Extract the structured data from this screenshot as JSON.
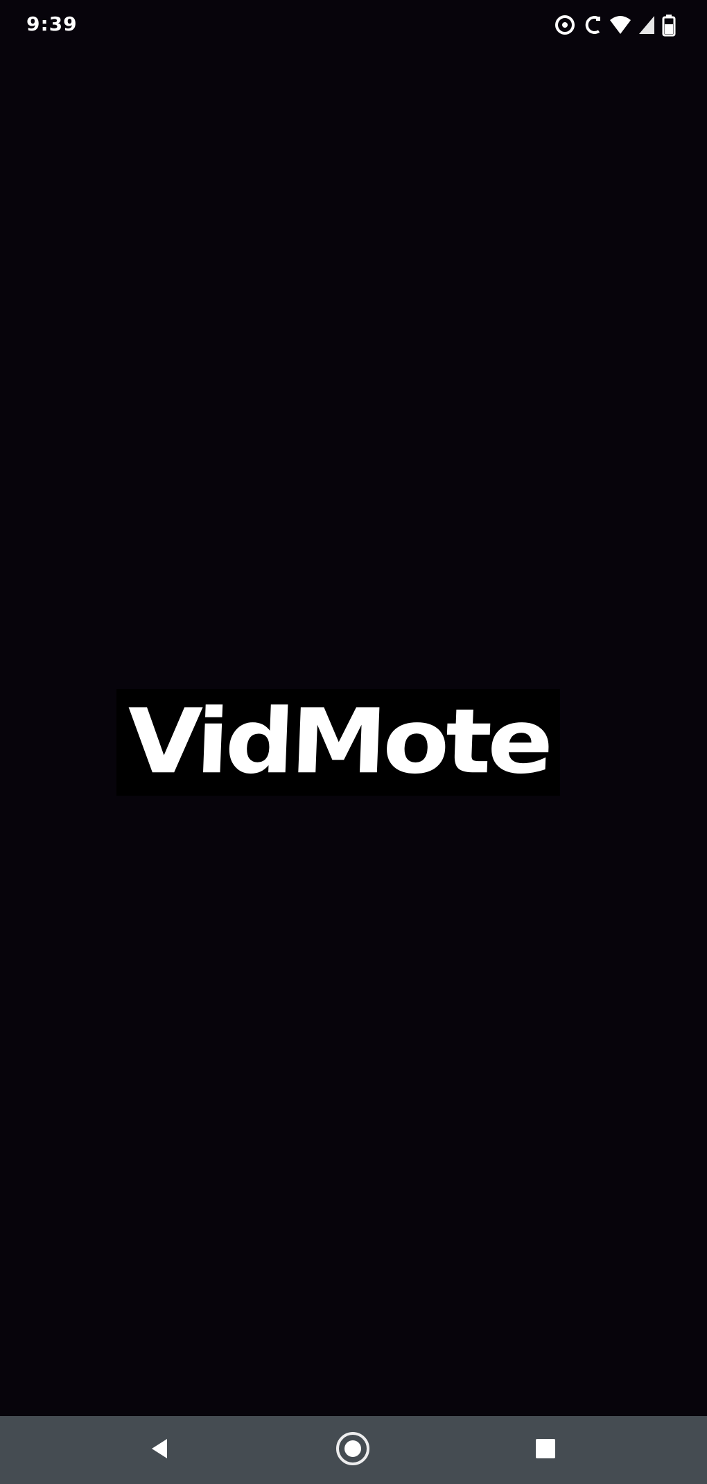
{
  "status_bar": {
    "time": "9:39",
    "icons": [
      "eye-comfort-icon",
      "cast-icon",
      "wifi-icon",
      "signal-icon",
      "battery-icon"
    ]
  },
  "splash": {
    "logo_text": "VidMote"
  },
  "nav_bar": {
    "buttons": [
      "back-icon",
      "home-icon",
      "recents-icon"
    ]
  },
  "colors": {
    "background": "#07040b",
    "logo_box": "#000000",
    "logo_text": "#ffffff",
    "nav_bar": "#454c52"
  }
}
